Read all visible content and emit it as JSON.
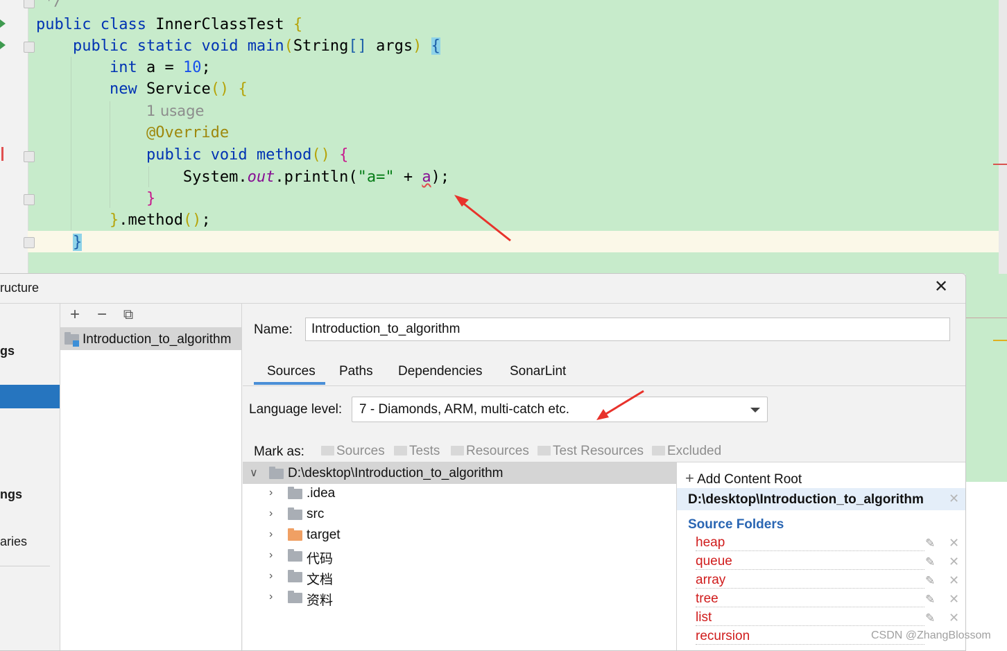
{
  "editor": {
    "comment_tail": "*/",
    "lines": {
      "class_decl": {
        "kw1": "public",
        "kw2": "class",
        "name": "InnerClassTest",
        "brace": "{"
      },
      "main_decl": {
        "kw1": "public",
        "kw2": "static",
        "kw3": "void",
        "name": "main",
        "open": "(",
        "type": "String",
        "arr": "[]",
        "param": "args",
        "close": ")",
        "brace": "{"
      },
      "int_decl": {
        "kw": "int",
        "rest": "a = ",
        "num": "10",
        "semi": ";"
      },
      "new_service": {
        "kw": "new",
        "name": "Service",
        "parens": "()",
        "brace": "{"
      },
      "usage_hint": "1 usage",
      "override": "@Override",
      "method_decl": {
        "kw1": "public",
        "kw2": "void",
        "name": "method",
        "parens": "()",
        "brace": "{"
      },
      "println": {
        "sys": "System.",
        "field": "out",
        "call": ".println(",
        "str": "\"a=\"",
        "plus": " + ",
        "var": "a",
        "close": ");"
      },
      "inner_close": "}",
      "method_call": {
        "brace": "}",
        "rest": ".method",
        "parens": "()",
        "semi": ";"
      },
      "main_close": "}"
    }
  },
  "dialog": {
    "title": "ructure",
    "close_label": "✕",
    "nav_items": [
      "gs",
      "ngs",
      "aries"
    ],
    "toolbar": {
      "add": "+",
      "remove": "−",
      "copy": "⧉"
    },
    "module_name": "Introduction_to_algorithm",
    "name_label": "Name:",
    "name_value": "Introduction_to_algorithm",
    "tabs": [
      "Sources",
      "Paths",
      "Dependencies",
      "SonarLint"
    ],
    "active_tab": "Sources",
    "language_level_label": "Language level:",
    "language_level_value": "7 - Diamonds, ARM, multi-catch etc.",
    "mark_as_label": "Mark as:",
    "mark_as_buttons": [
      "Sources",
      "Tests",
      "Resources",
      "Test Resources",
      "Excluded"
    ],
    "tree": {
      "root": "D:\\desktop\\Introduction_to_algorithm",
      "children": [
        ".idea",
        "src",
        "target",
        "代码",
        "文档",
        "资料"
      ]
    },
    "content_roots": {
      "add_label": "Add Content Root",
      "root_path": "D:\\desktop\\Introduction_to_algorithm",
      "source_header": "Source Folders",
      "source_folders": [
        "heap",
        "queue",
        "array",
        "tree",
        "list",
        "recursion"
      ]
    }
  },
  "watermark": "CSDN @ZhangBlossom",
  "colors": {
    "editor_bg": "#c7ebcb",
    "keyword": "#0033b3",
    "selection": "#2675bf",
    "source_folder": "#d01c1c",
    "source_header": "#2a66b3",
    "annotation_arrow": "#e8322b"
  }
}
